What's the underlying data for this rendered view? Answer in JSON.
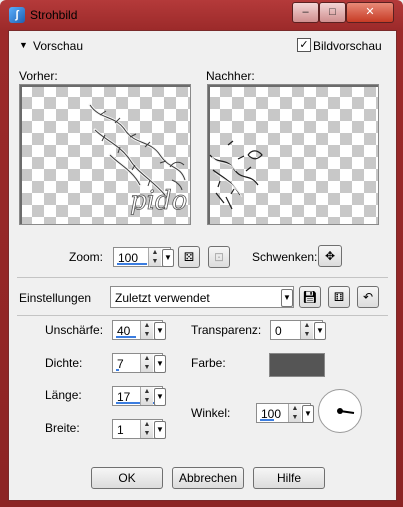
{
  "window": {
    "title": "Strohbild",
    "minimize": "–",
    "maximize": "□",
    "close": "✕"
  },
  "preview": {
    "section_label": "Vorschau",
    "show_preview_label": "Bildvorschau",
    "show_preview_checked": true,
    "before_label": "Vorher:",
    "after_label": "Nachher:",
    "watermark": "pido"
  },
  "zoom": {
    "label": "Zoom:",
    "value": "100",
    "pan_label": "Schwenken:"
  },
  "settings": {
    "label": "Einstellungen",
    "preset": "Zuletzt verwendet"
  },
  "params": {
    "blur_label": "Unschärfe:",
    "blur_value": "40",
    "density_label": "Dichte:",
    "density_value": "7",
    "length_label": "Länge:",
    "length_value": "17",
    "width_label": "Breite:",
    "width_value": "1",
    "transparency_label": "Transparenz:",
    "transparency_value": "0",
    "color_label": "Farbe:",
    "color_value": "#555555",
    "angle_label": "Winkel:",
    "angle_value": "100"
  },
  "buttons": {
    "ok": "OK",
    "cancel": "Abbrechen",
    "help": "Hilfe"
  }
}
